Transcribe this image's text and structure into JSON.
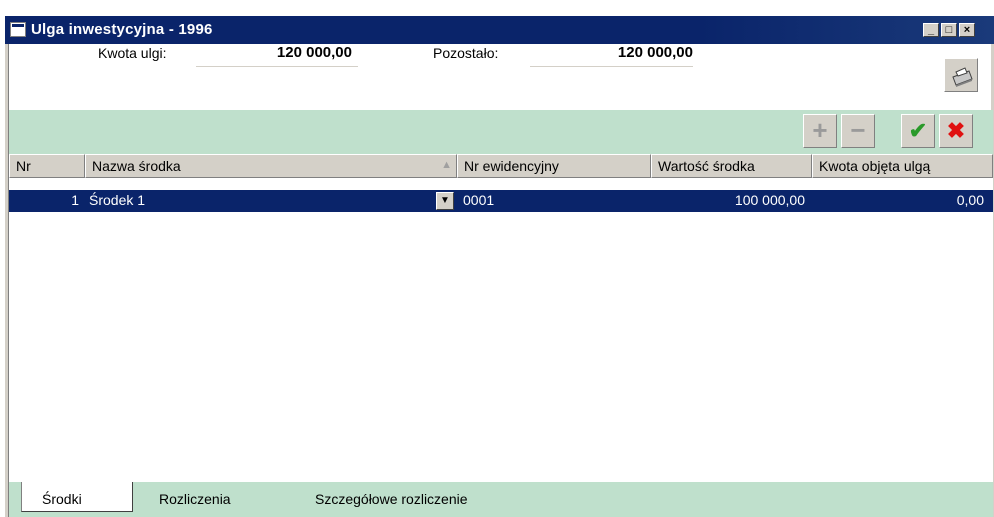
{
  "window": {
    "title": "Ulga inwestycyjna - 1996",
    "min_label": "_",
    "max_label": "□",
    "close_label": "×"
  },
  "summary": {
    "kwota_label": "Kwota ulgi:",
    "kwota_value": "120 000,00",
    "pozostalo_label": "Pozostało:",
    "pozostalo_value": "120 000,00"
  },
  "toolbar": {
    "print_icon": "printer-icon",
    "add_label": "+",
    "remove_label": "−",
    "accept_label": "✔",
    "cancel_label": "✖"
  },
  "table": {
    "columns": [
      "Nr",
      "Nazwa środka",
      "Nr ewidencyjny",
      "Wartość środka",
      "Kwota objęta ulgą"
    ],
    "sort_indicator": "▲",
    "rows": [
      {
        "nr": "1",
        "nazwa": "Środek 1",
        "ewidencyjny": "0001",
        "wartosc": "100 000,00",
        "kwota": "0,00"
      }
    ],
    "dropdown_glyph": "▼"
  },
  "tabs": [
    "Środki",
    "Rozliczenia",
    "Szczegółowe rozliczenie"
  ],
  "colors": {
    "title_bar": "#0a246a",
    "accent_strip": "#bfe0cc",
    "selection": "#0a246a",
    "face": "#d4d0c8"
  }
}
